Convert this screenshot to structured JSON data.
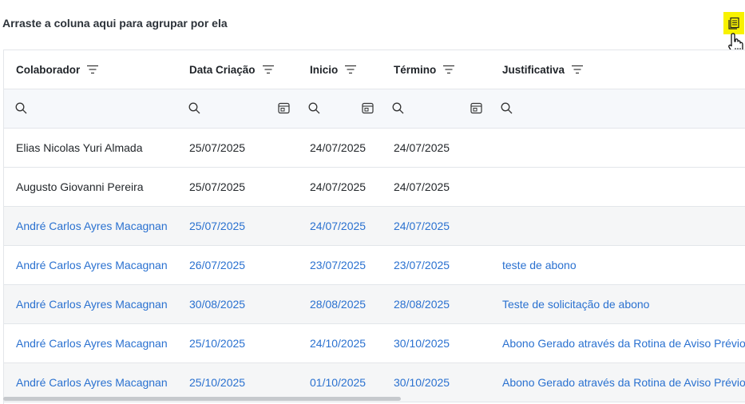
{
  "group_panel": {
    "hint": "Arraste a coluna aqui para agrupar por ela"
  },
  "columns": [
    {
      "label": "Colaborador"
    },
    {
      "label": "Data Criação"
    },
    {
      "label": "Inicio"
    },
    {
      "label": "Término"
    },
    {
      "label": "Justificativa"
    }
  ],
  "rows": [
    {
      "colaborador": "Elias Nicolas Yuri Almada",
      "data_criacao": "25/07/2025",
      "inicio": "24/07/2025",
      "termino": "24/07/2025",
      "justificativa": "",
      "link": false,
      "alt": false
    },
    {
      "colaborador": "Augusto Giovanni Pereira",
      "data_criacao": "25/07/2025",
      "inicio": "24/07/2025",
      "termino": "24/07/2025",
      "justificativa": "",
      "link": false,
      "alt": false
    },
    {
      "colaborador": "André Carlos Ayres Macagnan",
      "data_criacao": "25/07/2025",
      "inicio": "24/07/2025",
      "termino": "24/07/2025",
      "justificativa": "",
      "link": true,
      "alt": true
    },
    {
      "colaborador": "André Carlos Ayres Macagnan",
      "data_criacao": "26/07/2025",
      "inicio": "23/07/2025",
      "termino": "23/07/2025",
      "justificativa": "teste de abono",
      "link": true,
      "alt": false
    },
    {
      "colaborador": "André Carlos Ayres Macagnan",
      "data_criacao": "30/08/2025",
      "inicio": "28/08/2025",
      "termino": "28/08/2025",
      "justificativa": "Teste de solicitação de abono",
      "link": true,
      "alt": true
    },
    {
      "colaborador": "André Carlos Ayres Macagnan",
      "data_criacao": "25/10/2025",
      "inicio": "24/10/2025",
      "termino": "30/10/2025",
      "justificativa": "Abono Gerado através da Rotina de Aviso Prévio",
      "link": true,
      "alt": false
    },
    {
      "colaborador": "André Carlos Ayres Macagnan",
      "data_criacao": "25/10/2025",
      "inicio": "01/10/2025",
      "termino": "30/10/2025",
      "justificativa": "Abono Gerado através da Rotina de Aviso Prévio",
      "link": true,
      "alt": true
    }
  ],
  "colors": {
    "link": "#2a71d0",
    "highlight": "#f8f200",
    "border": "#e3e6ea"
  },
  "icons": [
    "filter-lines-icon",
    "search-icon",
    "calendar-icon",
    "column-chooser-icon",
    "hand-pointer-icon"
  ]
}
